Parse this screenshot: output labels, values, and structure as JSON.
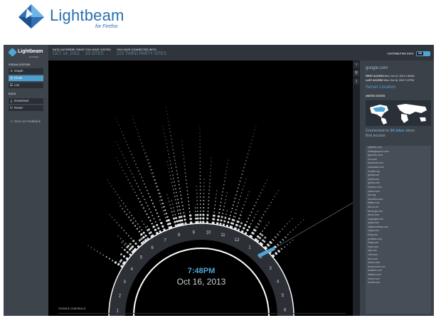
{
  "brand": {
    "title": "Lightbeam",
    "subtitle": "for Firefox"
  },
  "sidebar": {
    "logo": "Lightbeam",
    "logo_sub": "for Firefox",
    "visualization_heading": "VISUALIZATION",
    "items": [
      {
        "label": "Graph",
        "icon": "graph-icon"
      },
      {
        "label": "Clock",
        "icon": "clock-icon"
      },
      {
        "label": "List",
        "icon": "list-icon"
      }
    ],
    "data_heading": "DATA",
    "data_items": [
      {
        "label": "Download",
        "icon": "download-icon"
      },
      {
        "label": "Reset",
        "icon": "reset-icon"
      }
    ],
    "feedback": "Give Us Feedback"
  },
  "topbar": {
    "stats": [
      {
        "label": "DATA GATHERED SINCE",
        "value": "OCT 14, 2013"
      },
      {
        "label": "YOU HAVE VISITED",
        "value": "33 SITES"
      },
      {
        "label": "YOU HAVE CONNECTED WITH",
        "value": "223 THIRD PARTY SITES"
      }
    ],
    "contributing_label": "CONTRIBUTING DATA",
    "toggle_state": "ON"
  },
  "clock": {
    "time": "7:48PM",
    "date": "Oct 16, 2013",
    "hours": [
      "12",
      "1",
      "2",
      "3",
      "4",
      "5",
      "6",
      "7",
      "8",
      "9",
      "10",
      "11",
      "12",
      "1",
      "2",
      "3",
      "4",
      "5",
      "6",
      "7",
      "8",
      "9",
      "10",
      "11"
    ],
    "accent": "#4ea6d6"
  },
  "viz_footer": {
    "toggle_controls": "TOGGLE CONTROLS"
  },
  "panel": {
    "domain": "google.com",
    "first_access_label": "FIRST ACCESS",
    "first_access": "Mon, Oct 14, 2013 1:50AM",
    "last_access_label": "LAST ACCESS",
    "last_access": "Wed, Oct 16, 2013 7:47PM",
    "server_location": "Server Location",
    "country": "UNITED STATES",
    "connected_prefix": "Connected to",
    "connected_count": "34 sites",
    "connected_suffix": "since",
    "first_access_text": "first access",
    "sites": [
      "nytimes.com",
      "huffingtonpost.com",
      "gizmodo.com",
      "cnn.com",
      "facebook.com",
      "mashable.com",
      "mozilla.org",
      "gmail.com",
      "reddit.com",
      "github.com",
      "amazon.com",
      "yahoo.com",
      "npr.org",
      "nbcnews.com",
      "twitter.com",
      "bbc.co.uk",
      "theverge.com",
      "wired.com",
      "engadget.com",
      "apple.com",
      "stackoverflow.com",
      "imgur.com",
      "bing.com",
      "youtube.com",
      "ebay.com",
      "espn.com",
      "wsj.com",
      "cnet.com",
      "msn.com",
      "forbes.com",
      "techcrunch.com",
      "weather.com",
      "latimes.com",
      "vimeo.com",
      "tumblr.com"
    ]
  }
}
